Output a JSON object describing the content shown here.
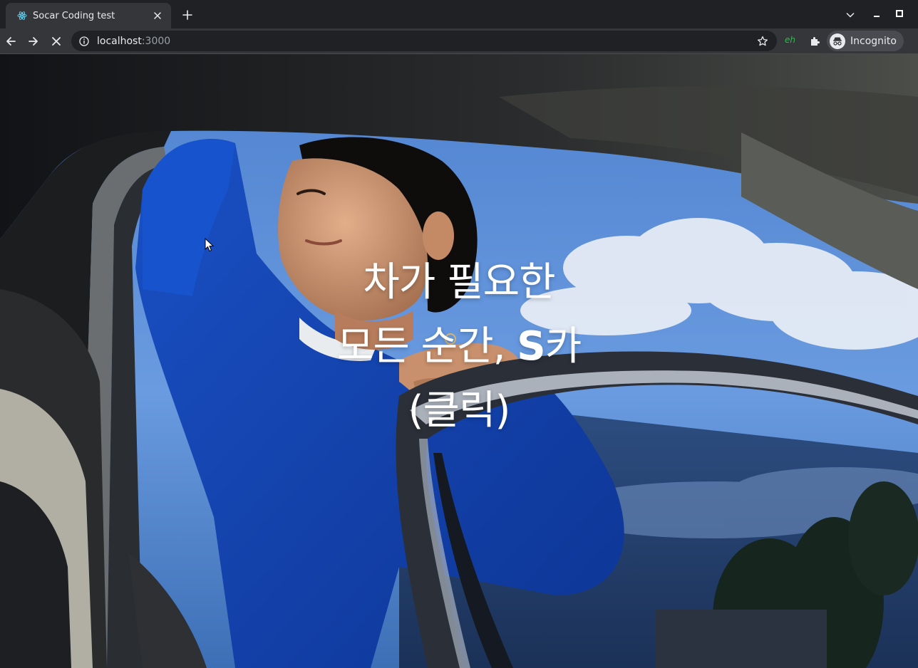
{
  "browser": {
    "tab": {
      "title": "Socar Coding test",
      "favicon": "react-icon"
    },
    "address": {
      "host": "localhost",
      "port": ":3000"
    },
    "extension_label": "eh",
    "profile_label": "Incognito",
    "icons": {
      "back": "arrow-left-icon",
      "forward": "arrow-right-icon",
      "stop": "close-icon",
      "info": "info-icon",
      "bookmark": "star-icon",
      "extensions": "puzzle-icon",
      "incognito": "incognito-icon"
    }
  },
  "hero": {
    "line1": "차가 필요한",
    "line2_prefix": "모든 순간, ",
    "line2_bold": "S",
    "line2_suffix": "카",
    "line3": "(클릭)"
  },
  "colors": {
    "tab_strip": "#202124",
    "toolbar": "#35363a",
    "text": "#e8eaed",
    "extension": "#2db84d",
    "hero_text": "#ffffff",
    "sweater": "#1447b8",
    "sky": "#5f8fd6"
  }
}
